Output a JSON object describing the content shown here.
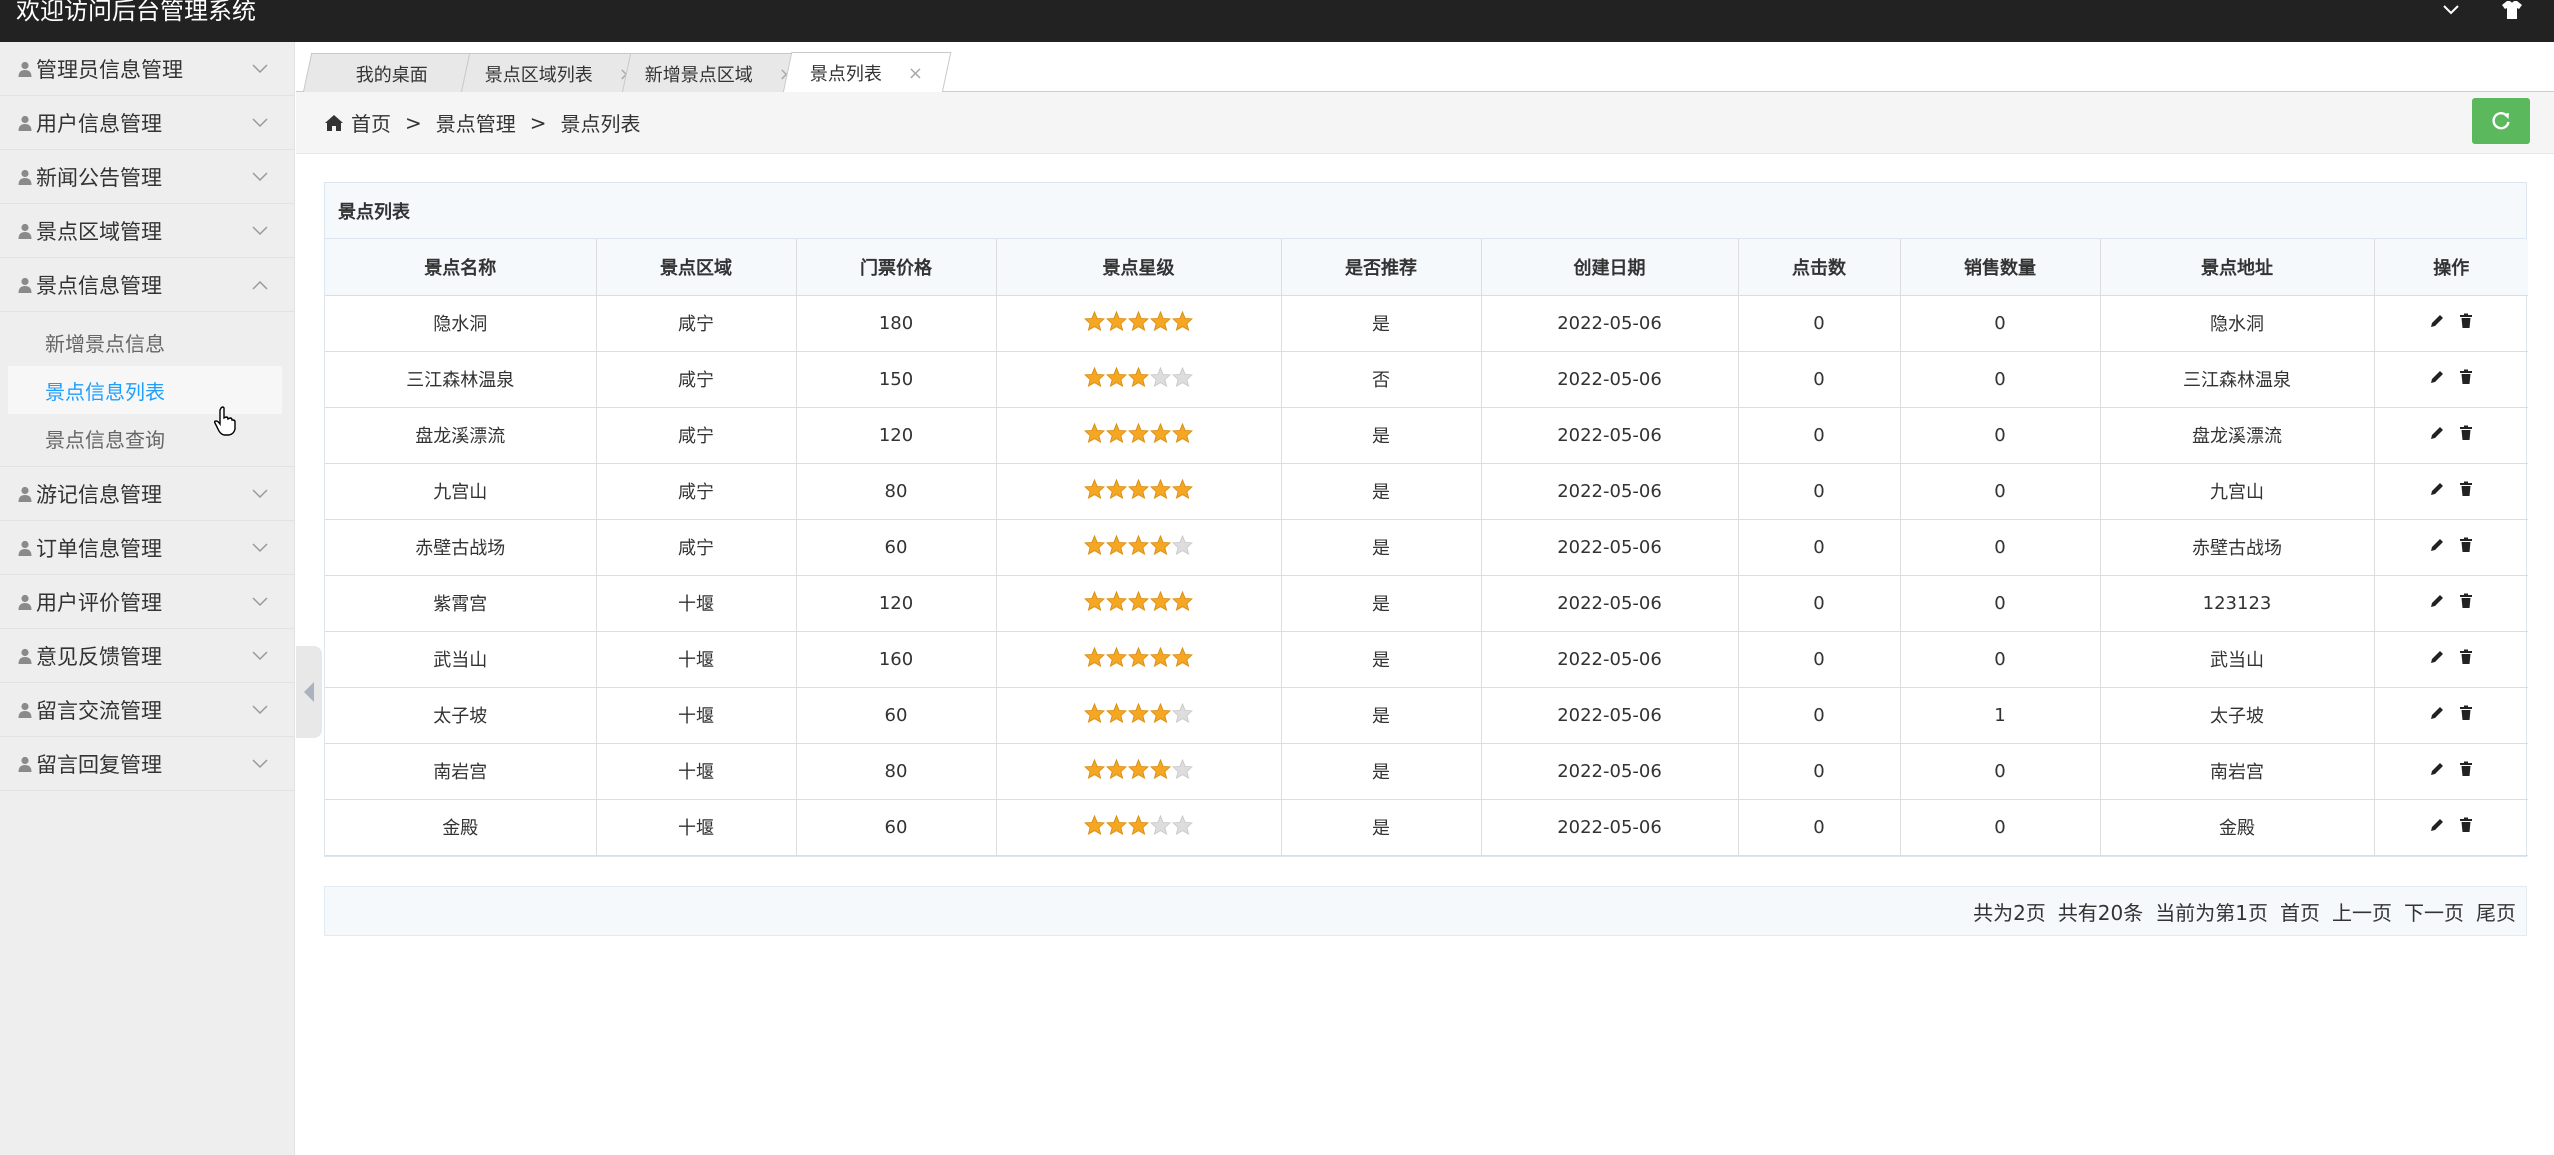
{
  "app": {
    "title": "欢迎访问后台管理系统"
  },
  "topbar": {
    "icons": [
      "chevron-down-icon",
      "shirt-icon"
    ]
  },
  "sidebar": {
    "items": [
      {
        "label": "管理员信息管理",
        "expanded": false
      },
      {
        "label": "用户信息管理",
        "expanded": false
      },
      {
        "label": "新闻公告管理",
        "expanded": false
      },
      {
        "label": "景点区域管理",
        "expanded": false
      },
      {
        "label": "景点信息管理",
        "expanded": true
      },
      {
        "label": "游记信息管理",
        "expanded": false
      },
      {
        "label": "订单信息管理",
        "expanded": false
      },
      {
        "label": "用户评价管理",
        "expanded": false
      },
      {
        "label": "意见反馈管理",
        "expanded": false
      },
      {
        "label": "留言交流管理",
        "expanded": false
      },
      {
        "label": "留言回复管理",
        "expanded": false
      }
    ],
    "submenu": [
      {
        "label": "新增景点信息",
        "active": false
      },
      {
        "label": "景点信息列表",
        "active": true
      },
      {
        "label": "景点信息查询",
        "active": false
      }
    ]
  },
  "tabs": [
    {
      "label": "我的桌面",
      "closable": false,
      "active": false
    },
    {
      "label": "景点区域列表",
      "closable": true,
      "active": false
    },
    {
      "label": "新增景点区域",
      "closable": true,
      "active": false
    },
    {
      "label": "景点列表",
      "closable": true,
      "active": true
    }
  ],
  "tab_close_glyph": "×",
  "breadcrumb": {
    "home": "首页",
    "separator": ">",
    "level1": "景点管理",
    "level2": "景点列表"
  },
  "panel": {
    "title": "景点列表"
  },
  "table": {
    "headers": [
      "景点名称",
      "景点区域",
      "门票价格",
      "景点星级",
      "是否推荐",
      "创建日期",
      "点击数",
      "销售数量",
      "景点地址",
      "操作"
    ],
    "rows": [
      {
        "name": "隐水洞",
        "area": "咸宁",
        "price": "180",
        "stars": 5,
        "recommended": "是",
        "date": "2022-05-06",
        "clicks": "0",
        "sales": "0",
        "address": "隐水洞"
      },
      {
        "name": "三江森林温泉",
        "area": "咸宁",
        "price": "150",
        "stars": 3,
        "recommended": "否",
        "date": "2022-05-06",
        "clicks": "0",
        "sales": "0",
        "address": "三江森林温泉"
      },
      {
        "name": "盘龙溪漂流",
        "area": "咸宁",
        "price": "120",
        "stars": 5,
        "recommended": "是",
        "date": "2022-05-06",
        "clicks": "0",
        "sales": "0",
        "address": "盘龙溪漂流"
      },
      {
        "name": "九宫山",
        "area": "咸宁",
        "price": "80",
        "stars": 5,
        "recommended": "是",
        "date": "2022-05-06",
        "clicks": "0",
        "sales": "0",
        "address": "九宫山"
      },
      {
        "name": "赤壁古战场",
        "area": "咸宁",
        "price": "60",
        "stars": 4,
        "recommended": "是",
        "date": "2022-05-06",
        "clicks": "0",
        "sales": "0",
        "address": "赤壁古战场"
      },
      {
        "name": "紫霄宫",
        "area": "十堰",
        "price": "120",
        "stars": 5,
        "recommended": "是",
        "date": "2022-05-06",
        "clicks": "0",
        "sales": "0",
        "address": "123123"
      },
      {
        "name": "武当山",
        "area": "十堰",
        "price": "160",
        "stars": 5,
        "recommended": "是",
        "date": "2022-05-06",
        "clicks": "0",
        "sales": "0",
        "address": "武当山"
      },
      {
        "name": "太子坡",
        "area": "十堰",
        "price": "60",
        "stars": 4,
        "recommended": "是",
        "date": "2022-05-06",
        "clicks": "0",
        "sales": "1",
        "address": "太子坡"
      },
      {
        "name": "南岩宫",
        "area": "十堰",
        "price": "80",
        "stars": 4,
        "recommended": "是",
        "date": "2022-05-06",
        "clicks": "0",
        "sales": "0",
        "address": "南岩宫"
      },
      {
        "name": "金殿",
        "area": "十堰",
        "price": "60",
        "stars": 3,
        "recommended": "是",
        "date": "2022-05-06",
        "clicks": "0",
        "sales": "0",
        "address": "金殿"
      }
    ],
    "max_stars": 5,
    "row_actions": [
      "pencil-icon",
      "trash-icon"
    ]
  },
  "pagination": {
    "total_pages": "共为2页",
    "total_items": "共有20条",
    "current": "当前为第1页",
    "first": "首页",
    "prev": "上一页",
    "next": "下一页",
    "last": "尾页"
  },
  "colors": {
    "topbar": "#222222",
    "sidebar": "#eeeeee",
    "active_link": "#1e9fff",
    "refresh_button": "#5cb85c",
    "star_filled": "#f5a623",
    "star_empty": "#dddddd"
  }
}
